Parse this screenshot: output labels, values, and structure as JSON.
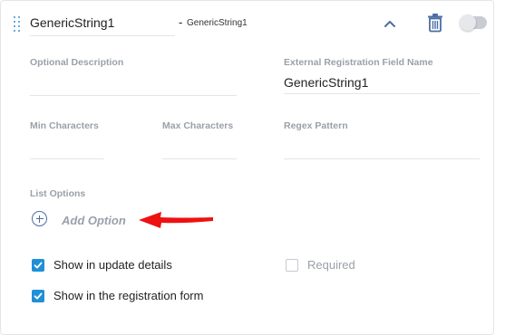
{
  "header": {
    "field_name_value": "GenericString1",
    "separator": "-",
    "field_subtitle": "GenericString1"
  },
  "fields": {
    "optional_description_label": "Optional Description",
    "optional_description_value": "",
    "external_field_label": "External Registration Field Name",
    "external_field_value": "GenericString1",
    "min_characters_label": "Min Characters",
    "min_characters_value": "",
    "max_characters_label": "Max Characters",
    "max_characters_value": "",
    "regex_label": "Regex Pattern",
    "regex_value": ""
  },
  "list_options": {
    "label": "List Options",
    "add_option_label": "Add Option"
  },
  "checkboxes": {
    "show_update_details": {
      "label": "Show in update details",
      "checked": true
    },
    "required": {
      "label": "Required",
      "checked": false
    },
    "show_registration_form": {
      "label": "Show in the registration form",
      "checked": true
    }
  },
  "icons": {
    "drag": "drag-handle-icon",
    "collapse": "chevron-up-icon",
    "delete": "trash-icon",
    "toggle": "toggle-switch",
    "add": "plus-circle-icon",
    "annotation": "red-arrow-icon"
  },
  "colors": {
    "accent": "#1f8fd6",
    "icon_blue": "#4b6ea3",
    "label_gray": "#9aa0ab",
    "annotation_red": "#ee1111"
  },
  "toggle": {
    "on": false
  }
}
